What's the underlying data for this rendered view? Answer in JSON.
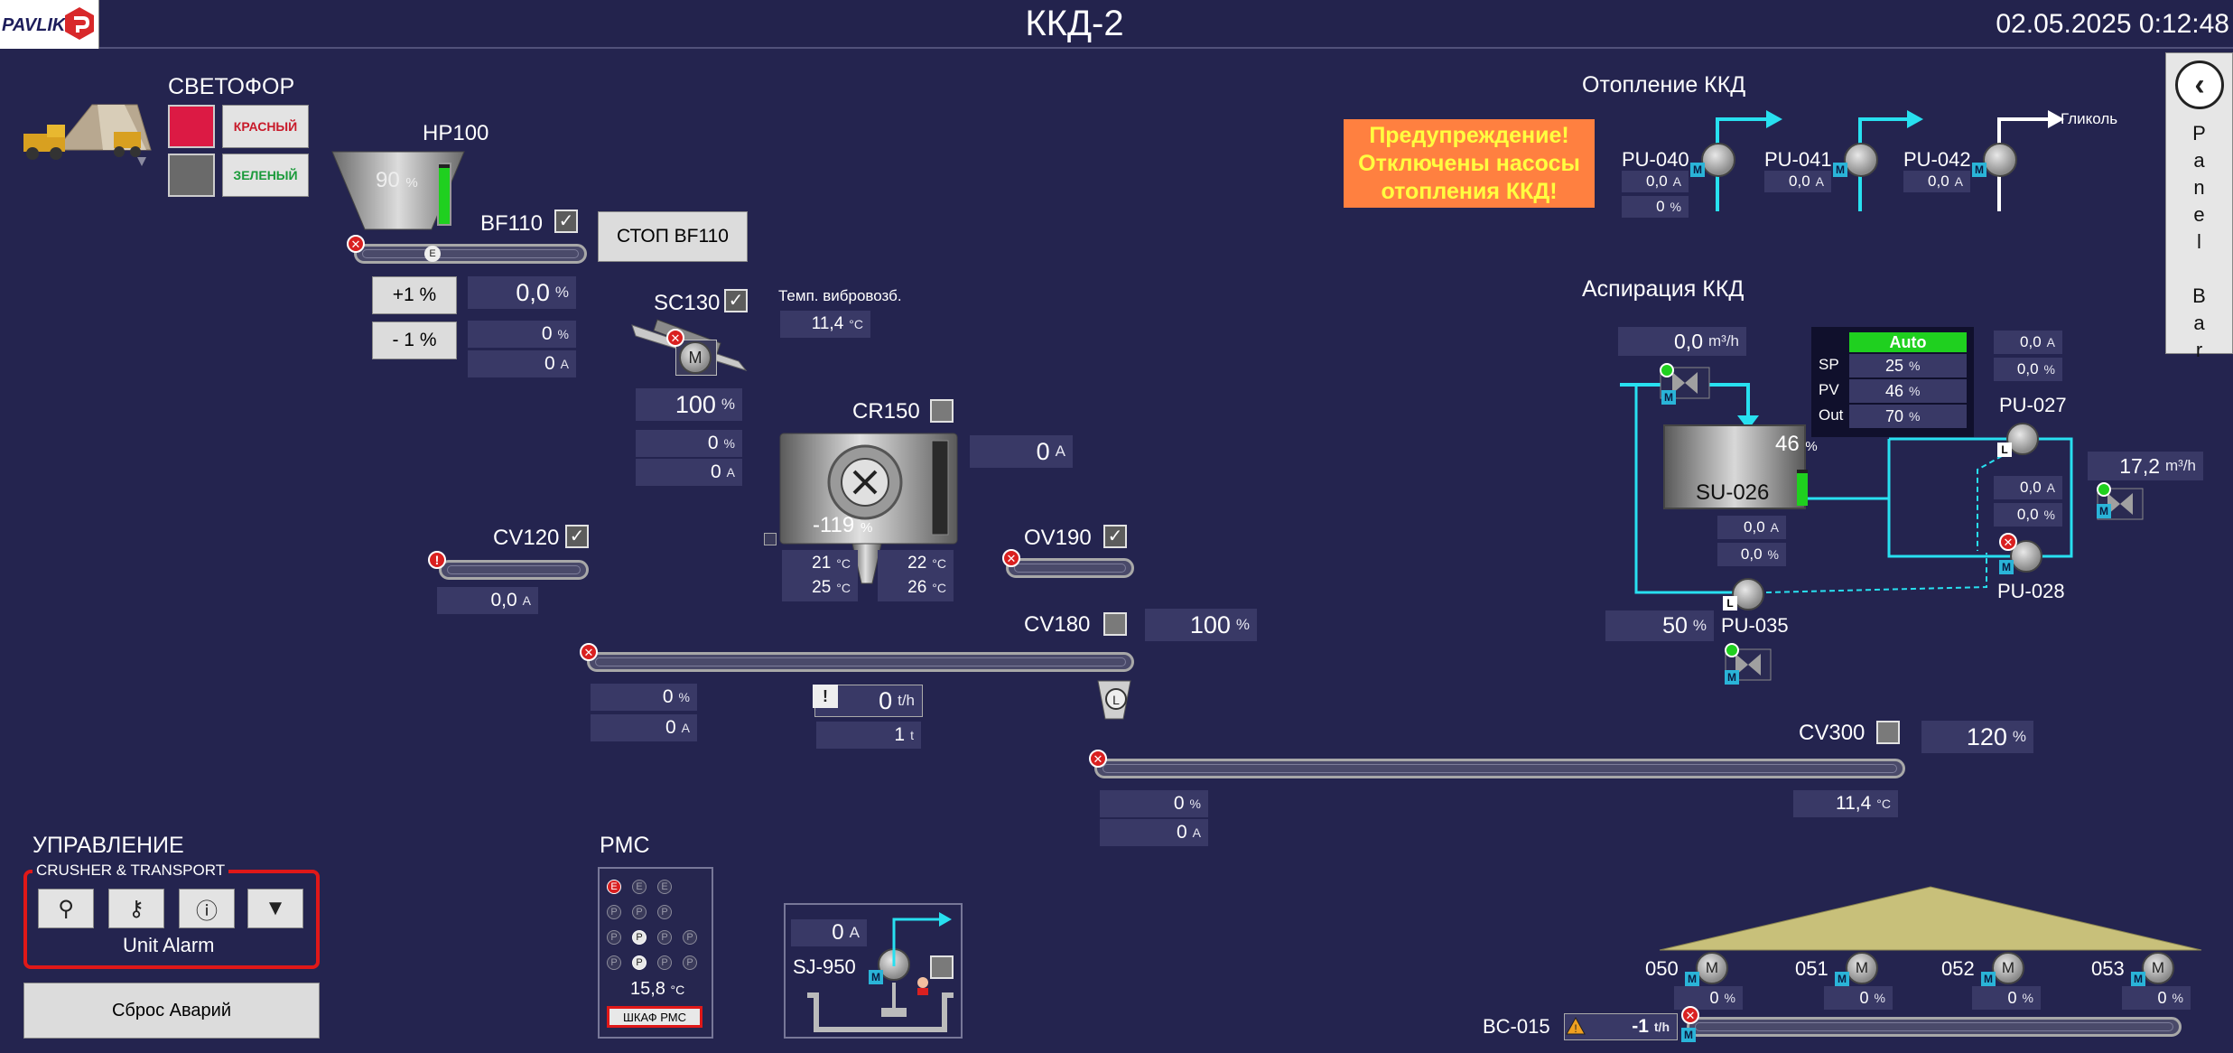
{
  "header": {
    "logo_text": "PAVLIK",
    "title": "ККД-2",
    "datetime": "02.05.2025 0:12:48"
  },
  "svetofor": {
    "title": "СВЕТОФОР",
    "red_label": "КРАСНЫЙ",
    "green_label": "ЗЕЛЕНЫЙ"
  },
  "hp100": {
    "name": "HP100",
    "level_value": "90",
    "level_unit": "%",
    "level_fraction": 0.9
  },
  "bf110": {
    "name": "BF110",
    "stop_button": "СТОП  BF110",
    "plus_button": "+1 %",
    "minus_button": "- 1 %",
    "setpoint": "0,0",
    "setpoint_unit": "%",
    "speed": "0",
    "speed_unit": "%",
    "current": "0",
    "current_unit": "A"
  },
  "sc130": {
    "name": "SC130",
    "motor_label": "M",
    "temp_label": "Темп. вибровозб.",
    "temp_value": "11,4",
    "temp_unit": "°C",
    "setpoint": "100",
    "setpoint_unit": "%",
    "speed": "0",
    "speed_unit": "%",
    "current": "0",
    "current_unit": "A"
  },
  "cr150": {
    "name": "CR150",
    "current": "0",
    "current_unit": "A",
    "level": "-119",
    "level_unit": "%",
    "temps": [
      {
        "value": "21",
        "unit": "°C"
      },
      {
        "value": "22",
        "unit": "°C"
      },
      {
        "value": "25",
        "unit": "°C"
      },
      {
        "value": "26",
        "unit": "°C"
      }
    ]
  },
  "cv120": {
    "name": "CV120",
    "current": "0,0",
    "current_unit": "A"
  },
  "ov190": {
    "name": "OV190"
  },
  "cv180": {
    "name": "CV180",
    "setpoint": "100",
    "setpoint_unit": "%",
    "speed": "0",
    "speed_unit": "%",
    "current": "0",
    "current_unit": "A",
    "flow": "0",
    "flow_unit": "t/h",
    "total": "1",
    "total_unit": "t",
    "warning_mark": "!"
  },
  "cv300": {
    "name": "CV300",
    "setpoint": "120",
    "setpoint_unit": "%",
    "speed": "0",
    "speed_unit": "%",
    "current": "0",
    "current_unit": "A",
    "temp": "11,4",
    "temp_unit": "°C"
  },
  "warning": {
    "lines": [
      "Предупреждение!",
      "Отключены насосы",
      "отопления ККД!"
    ]
  },
  "heating": {
    "title": "Отопление ККД",
    "glycol_label": "Гликоль",
    "pumps": [
      {
        "name": "PU-040",
        "current": "0,0",
        "current_unit": "A",
        "speed": "0",
        "speed_unit": "%"
      },
      {
        "name": "PU-041",
        "current": "0,0",
        "current_unit": "A"
      },
      {
        "name": "PU-042",
        "current": "0,0",
        "current_unit": "A"
      }
    ]
  },
  "aspiration": {
    "title": "Аспирация ККД",
    "flow_in": "0,0",
    "flow_in_unit": "m³/h",
    "mode": "Auto",
    "pid": [
      {
        "label": "SP",
        "value": "25",
        "unit": "%"
      },
      {
        "label": "PV",
        "value": "46",
        "unit": "%"
      },
      {
        "label": "Out",
        "value": "70",
        "unit": "%"
      }
    ],
    "su026": {
      "name": "SU-026",
      "level": "46",
      "level_unit": "%",
      "level_fraction": 0.46,
      "current": "0,0",
      "current_unit": "A",
      "speed": "0,0",
      "speed_unit": "%"
    },
    "pu027": {
      "name": "PU-027",
      "current": "0,0",
      "current_unit": "A",
      "speed": "0,0",
      "speed_unit": "%"
    },
    "pu028": {
      "name": "PU-028",
      "current": "0,0",
      "current_unit": "A",
      "speed": "0,0",
      "speed_unit": "%"
    },
    "pu035": {
      "name": "PU-035",
      "speed": "50",
      "speed_unit": "%"
    },
    "flow_out": "17,2",
    "flow_out_unit": "m³/h"
  },
  "control": {
    "title": "УПРАВЛЕНИЕ",
    "group_label": "CRUSHER & TRANSPORT",
    "alarm_text": "Unit Alarm",
    "reset_button": "Сброс Аварий"
  },
  "pmc": {
    "title": "PMC",
    "temp": "15,8",
    "temp_unit": "°C",
    "cabinet_button": "ШКАФ РМС"
  },
  "sj950": {
    "name": "SJ-950",
    "current": "0",
    "current_unit": "A"
  },
  "feeders": [
    {
      "name": "050",
      "speed": "0",
      "unit": "%"
    },
    {
      "name": "051",
      "speed": "0",
      "unit": "%"
    },
    {
      "name": "052",
      "speed": "0",
      "unit": "%"
    },
    {
      "name": "053",
      "speed": "0",
      "unit": "%"
    }
  ],
  "bc015": {
    "name": "BC-015",
    "flow": "-1",
    "flow_unit": "t/h"
  },
  "panel_bar": {
    "text": "Panel Bar",
    "letters": [
      "P",
      "a",
      "n",
      "e",
      "l",
      "",
      "B",
      "a",
      "r"
    ]
  },
  "colors": {
    "background": "#24244f",
    "accent_cyan": "#28e0f0",
    "alarm_red": "#d92020",
    "warning_orange": "#ff8040",
    "warning_text": "#ffff40",
    "auto_green": "#1fd01f"
  }
}
